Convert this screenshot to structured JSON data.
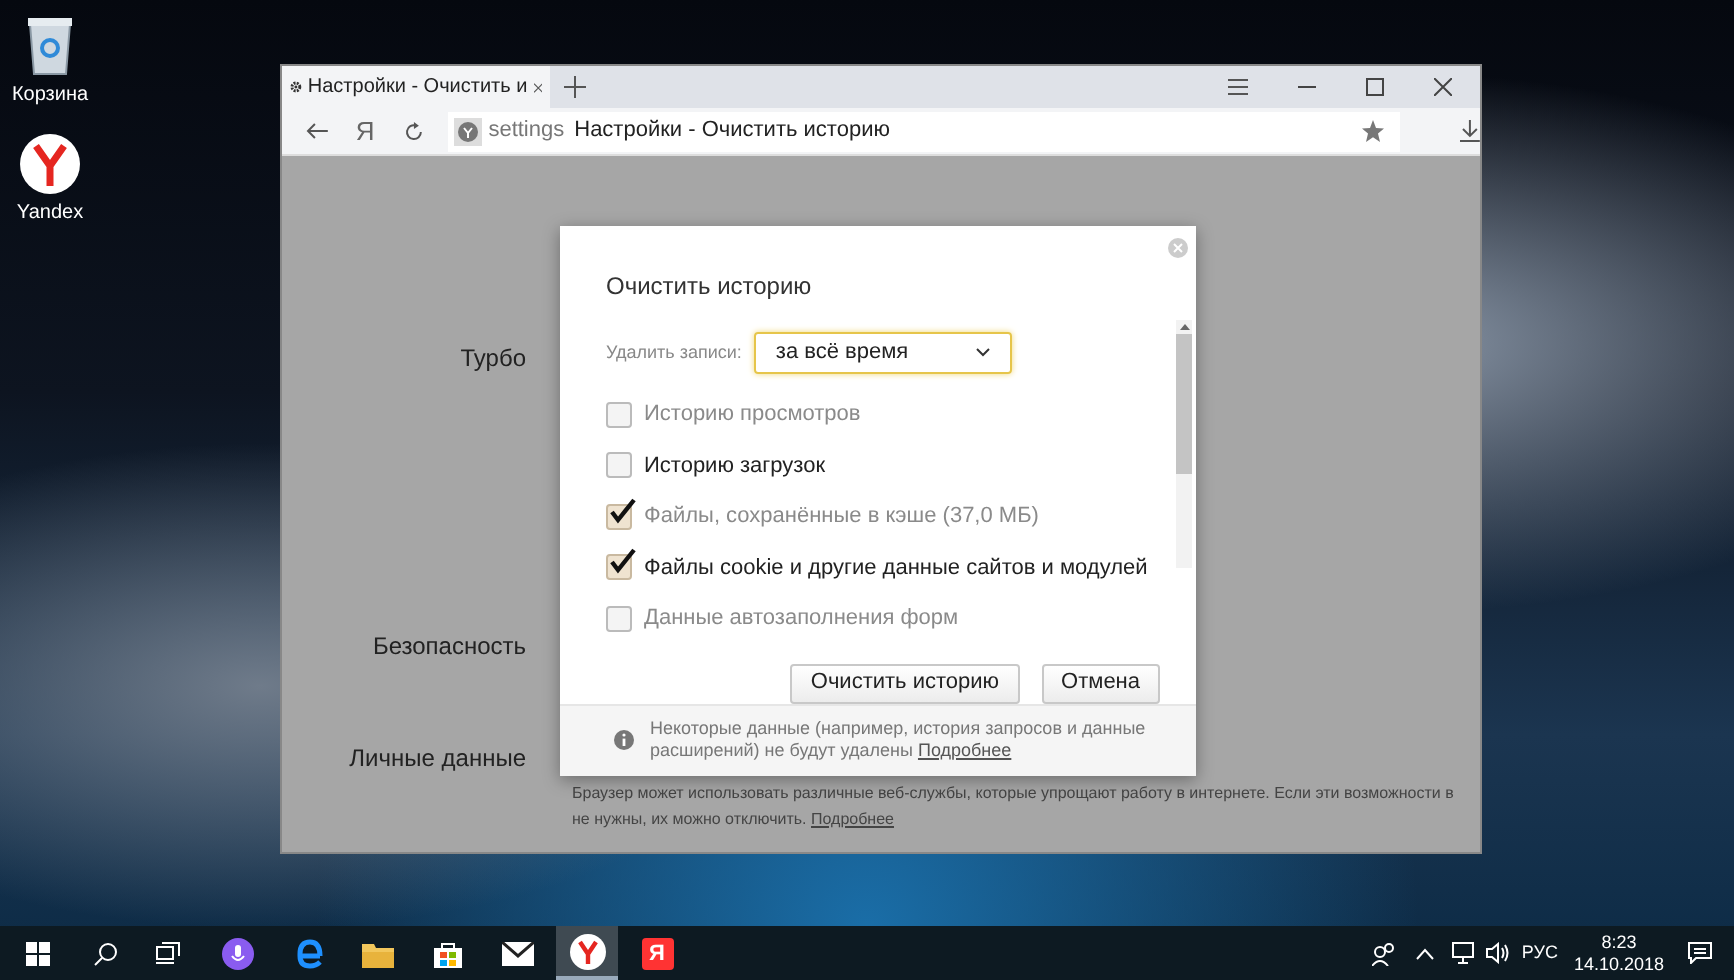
{
  "desktop_icons": [
    {
      "label": "Корзина",
      "kind": "bin"
    },
    {
      "label": "Yandex",
      "kind": "yandex"
    }
  ],
  "browser": {
    "tab": {
      "title": "Настройки - Очистить и",
      "selected": true
    },
    "nav": {
      "yandex_button": "Я"
    },
    "address": {
      "prefix": "settings",
      "title": "Настройки - Очистить историю"
    },
    "settings_sections": [
      {
        "label": "Турбо"
      },
      {
        "label": "Безопасность"
      },
      {
        "label": "Личные данные"
      }
    ],
    "personal_text": "Браузер может использовать различные веб-службы, которые упрощают работу в интернете. Если эти возможности в",
    "personal_text_2": "не нужны, их можно отключить.",
    "personal_link": "Подробнее"
  },
  "dialog": {
    "title": "Очистить историю",
    "period_label": "Удалить записи:",
    "period_value": "за всё время",
    "items": [
      {
        "label": "Историю просмотров",
        "checked": false,
        "dimmed": true
      },
      {
        "label": "Историю загрузок",
        "checked": false,
        "dimmed": false
      },
      {
        "label": "Файлы, сохранённые в кэше (37,0 МБ)",
        "checked": true,
        "dimmed": true
      },
      {
        "label": "Файлы cookie и другие данные сайтов и модулей",
        "checked": true,
        "dimmed": false
      },
      {
        "label": "Данные автозаполнения форм",
        "checked": false,
        "dimmed": true
      }
    ],
    "buttons": [
      "Очистить историю",
      "Отмена"
    ],
    "note": "Некоторые данные (например, история запросов и данные расширений) не будут удалены",
    "note_link": "Подробнее"
  },
  "taskbar": {
    "pinned": [
      {
        "kind": "alice",
        "selected": false
      },
      {
        "kind": "edge",
        "selected": false
      },
      {
        "kind": "folder",
        "selected": false
      },
      {
        "kind": "store",
        "selected": false
      },
      {
        "kind": "mail",
        "selected": false
      },
      {
        "kind": "browser",
        "selected": true
      },
      {
        "kind": "letter",
        "label": "Я",
        "selected": false
      }
    ],
    "language": "РУС",
    "time": "8:23",
    "date": "14.10.2018"
  }
}
